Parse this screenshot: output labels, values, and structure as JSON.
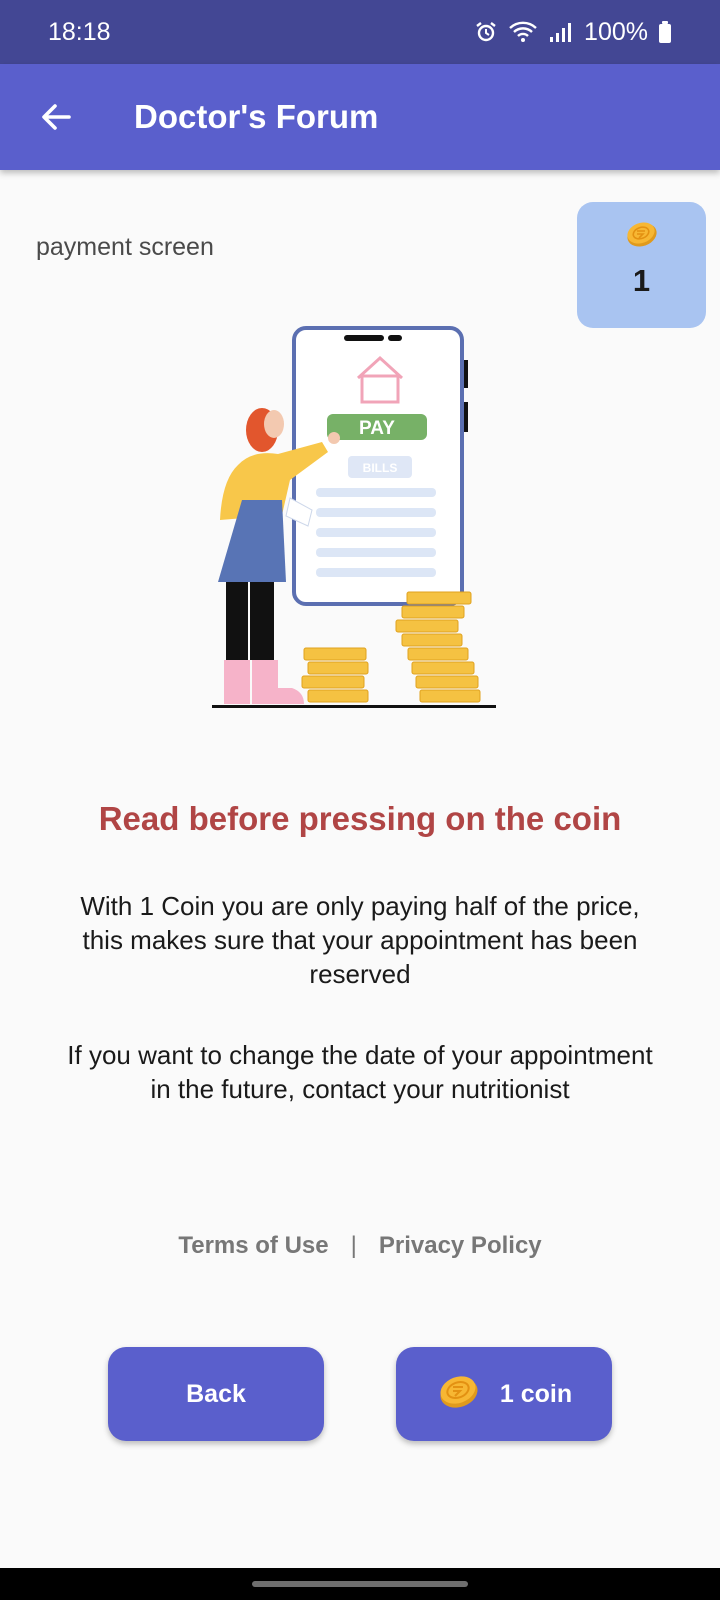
{
  "status_bar": {
    "time": "18:18",
    "battery": "100%",
    "icons": [
      "alarm-icon",
      "wifi-icon",
      "signal-icon",
      "battery-icon"
    ]
  },
  "app_bar": {
    "title": "Doctor's Forum",
    "back_icon": "arrow-left-icon"
  },
  "page": {
    "subtitle": "payment screen"
  },
  "coin_badge": {
    "icon": "coin-icon",
    "count": "1"
  },
  "illustration": {
    "pay_label": "PAY",
    "bills_label": "BILLS"
  },
  "content": {
    "heading": "Read before pressing on the coin",
    "paragraph_1": "With 1 Coin you are only paying half of the price, this makes sure that your appointment has been reserved",
    "paragraph_2": "If you want to change the date of your appointment in the future, contact your nutritionist"
  },
  "links": {
    "terms": "Terms of Use",
    "separator": "|",
    "privacy": "Privacy Policy"
  },
  "buttons": {
    "back_label": "Back",
    "coin_label": "1 coin"
  },
  "colors": {
    "status_bar": "#434794",
    "primary": "#5a5fcc",
    "badge": "#a9c4f1",
    "heading": "#b04545",
    "coin": "#f5b42e"
  }
}
